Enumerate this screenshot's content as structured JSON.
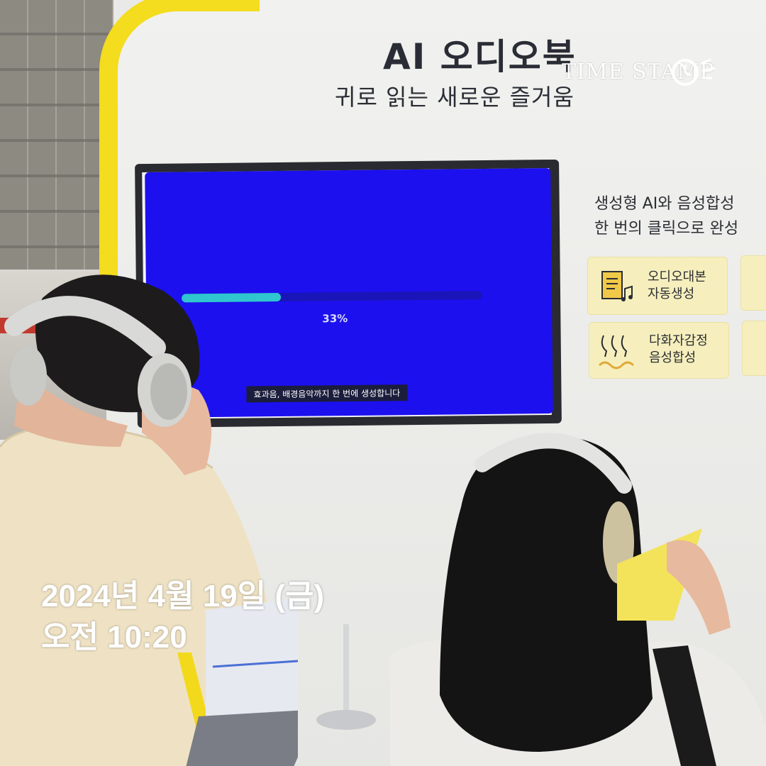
{
  "photo": {
    "booth_title": "AI 오디오북",
    "booth_subtitle": "귀로 읽는 새로운 즐거움",
    "monitor_screen": {
      "progress_percent": 33,
      "progress_label": "33%",
      "caption": "효과음, 배경음악까지 한 번에 생성합니다",
      "screen_color": "#1c10ee",
      "progress_color": "#2fc6cf"
    },
    "feature_panel": {
      "headline_line1": "생성형 AI와 음성합성",
      "headline_line2": "한 번의 클릭으로 완성",
      "cards": [
        {
          "label": "오디오대본\n자동생성",
          "icon": "script-music-icon"
        },
        {
          "label": "다화자감정\n음성합성",
          "icon": "faces-voice-icon"
        }
      ]
    },
    "accent_yellow": "#f4dc1e"
  },
  "timestamp_watermark": {
    "text": "TIME STAMP",
    "icon": "clock-icon"
  },
  "date_overlay": {
    "date": "2024년 4월 19일 (금)",
    "time": "오전 10:20"
  }
}
